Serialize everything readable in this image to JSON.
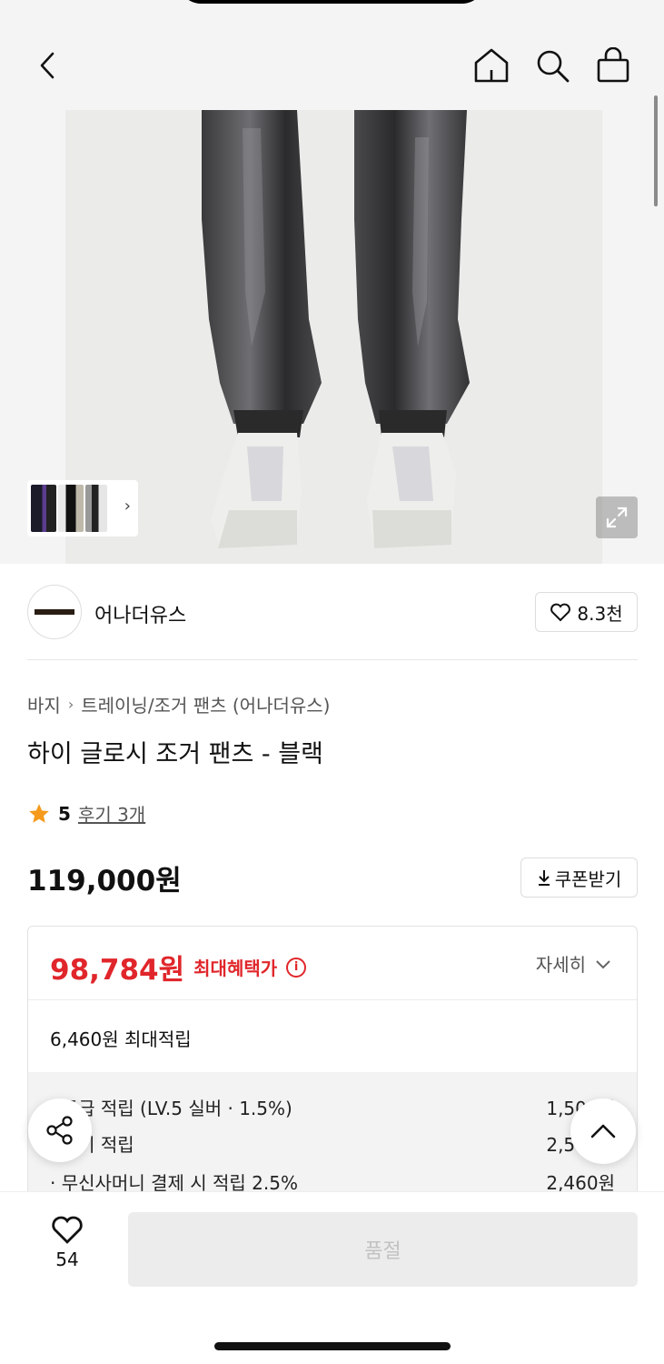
{
  "product_image": {
    "alt": "하이 글로시 조거 팬츠 - 블랙"
  },
  "brand": {
    "name": "어나더유스",
    "likes": "8.3천"
  },
  "breadcrumb": {
    "category": "바지",
    "subcategory": "트레이닝/조거 팬츠 (어나더유스)"
  },
  "product": {
    "title": "하이 글로시 조거 팬츠 - 블랙",
    "rating": "5",
    "reviews": "후기 3개",
    "price": "119,000원"
  },
  "coupon": {
    "label": "쿠폰받기"
  },
  "benefit": {
    "max_price": "98,784원",
    "max_label": "최대혜택가",
    "detail_label": "자세히",
    "max_points": "6,460원 최대적립",
    "rows": [
      {
        "label": "· 등급 적립 (LV.5 실버 · 1.5%)",
        "value": "1,500원"
      },
      {
        "label": "· 후기 적립",
        "value": "2,500원"
      },
      {
        "label": "· 무신사머니 결제 시 적립 2.5%",
        "value": "2,460원"
      }
    ]
  },
  "bottom": {
    "wish_count": "54",
    "buy_label": "품절"
  },
  "colors": {
    "accent_red": "#e0262b",
    "muted": "#c2c2c2"
  }
}
